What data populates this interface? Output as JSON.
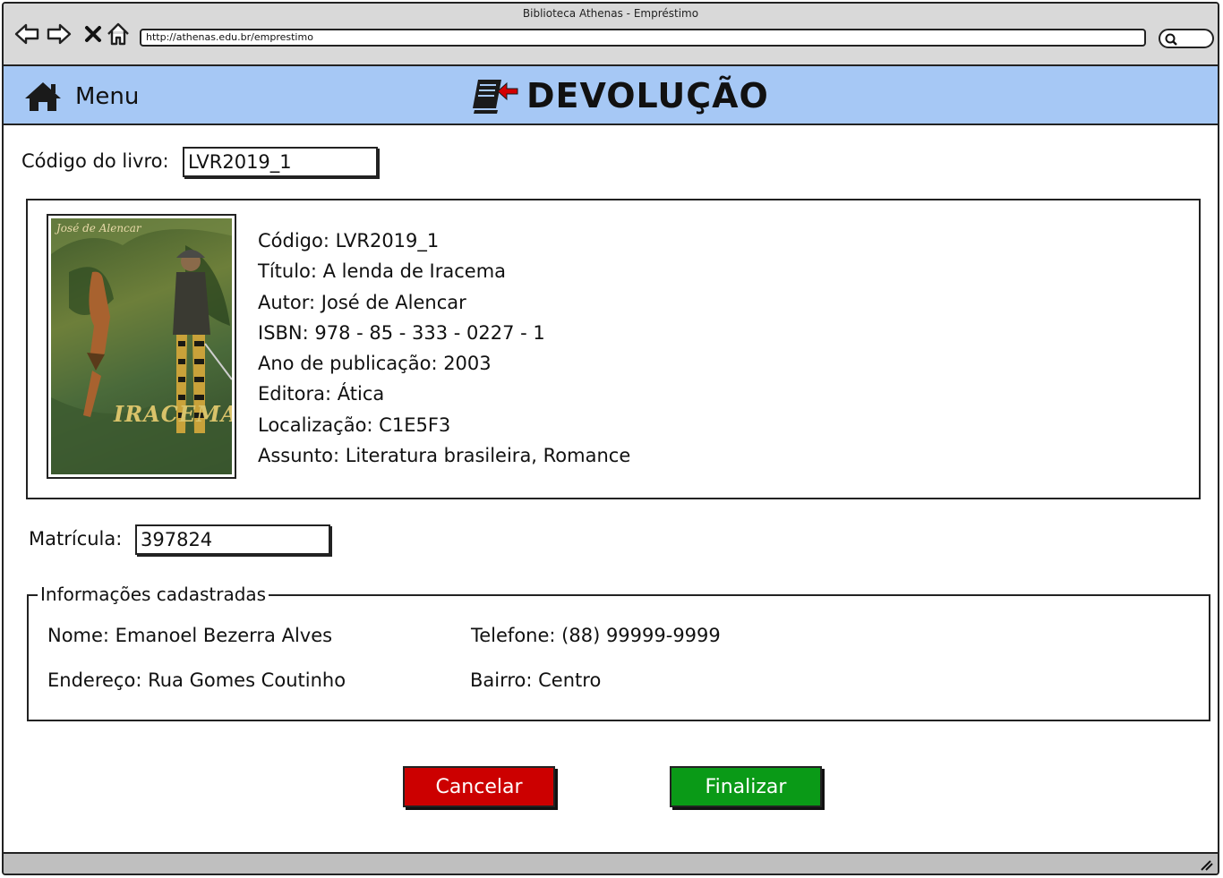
{
  "window": {
    "title": "Biblioteca Athenas - Empréstimo"
  },
  "browser": {
    "url": "http://athenas.edu.br/emprestimo"
  },
  "header": {
    "menu_label": "Menu",
    "page_title": "DEVOLUÇÃO",
    "background": "#a6c8f5"
  },
  "book_search": {
    "label": "Código do livro:",
    "value": "LVR2019_1"
  },
  "book": {
    "cover": {
      "author": "José de Alencar",
      "title": "IRACEMA"
    },
    "lines": [
      "Código: LVR2019_1",
      "Título: A lenda de Iracema",
      "Autor: José de Alencar",
      "ISBN: 978 - 85 - 333 - 0227 - 1",
      "Ano de publicação: 2003",
      "Editora: Ática",
      "Localização: C1E5F3",
      "Assunto: Literatura brasileira, Romance"
    ]
  },
  "registration": {
    "label": "Matrícula:",
    "value": "397824"
  },
  "user_info": {
    "legend": "Informações cadastradas",
    "name": "Nome: Emanoel Bezerra Alves",
    "phone": "Telefone: (88) 99999-9999",
    "address": "Endereço: Rua Gomes Coutinho",
    "district": "Bairro: Centro"
  },
  "actions": {
    "cancel_label": "Cancelar",
    "finish_label": "Finalizar",
    "cancel_color": "#cc0000",
    "finish_color": "#0a9a17"
  },
  "icons": {
    "back": "back-arrow-icon",
    "forward": "forward-arrow-icon",
    "stop": "close-icon",
    "home": "home-icon",
    "search": "search-icon",
    "menu": "home-icon",
    "title": "book-return-icon",
    "resize": "resize-grip-icon"
  }
}
